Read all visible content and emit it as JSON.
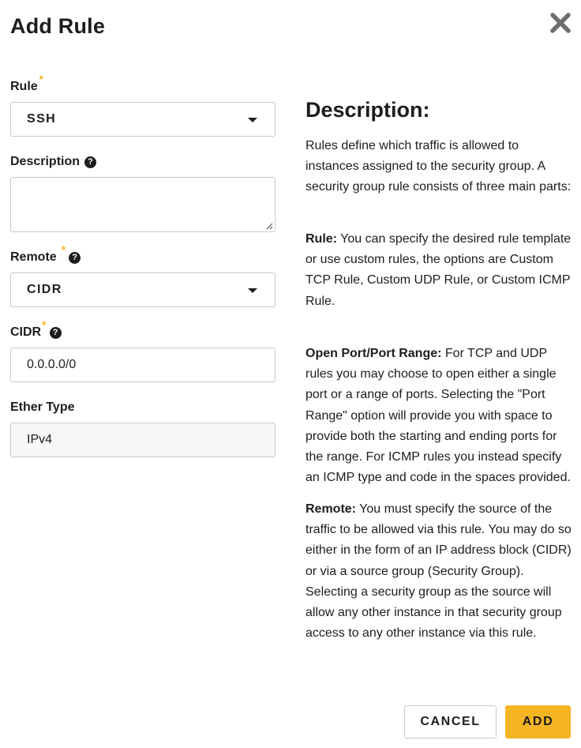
{
  "dialog": {
    "title": "Add Rule",
    "close_icon": "close-icon"
  },
  "form": {
    "rule": {
      "label": "Rule",
      "required_mark": "*",
      "value": "SSH"
    },
    "description": {
      "label": "Description",
      "value": ""
    },
    "remote": {
      "label": "Remote",
      "required_mark": "*",
      "value": "CIDR"
    },
    "cidr": {
      "label": "CIDR",
      "required_mark": "*",
      "value": "0.0.0.0/0"
    },
    "ether_type": {
      "label": "Ether Type",
      "value": "IPv4"
    },
    "help_icon_glyph": "?"
  },
  "help": {
    "heading": "Description:",
    "intro": "Rules define which traffic is allowed to instances assigned to the security group. A security group rule consists of three main parts:",
    "rule_title": "Rule:",
    "rule_text": " You can specify the desired rule template or use custom rules, the options are Custom TCP Rule, Custom UDP Rule, or Custom ICMP Rule.",
    "port_title": "Open Port/Port Range:",
    "port_text": " For TCP and UDP rules you may choose to open either a single port or a range of ports. Selecting the \"Port Range\" option will provide you with space to provide both the starting and ending ports for the range. For ICMP rules you instead specify an ICMP type and code in the spaces provided.",
    "remote_title": "Remote:",
    "remote_text": " You must specify the source of the traffic to be allowed via this rule. You may do so either in the form of an IP address block (CIDR) or via a source group (Security Group). Selecting a security group as the source will allow any other instance in that security group access to any other instance via this rule."
  },
  "footer": {
    "cancel_label": "CANCEL",
    "add_label": "ADD"
  },
  "colors": {
    "accent": "#f5b423",
    "text": "#1d1d1d",
    "border": "#c9c9c9"
  }
}
